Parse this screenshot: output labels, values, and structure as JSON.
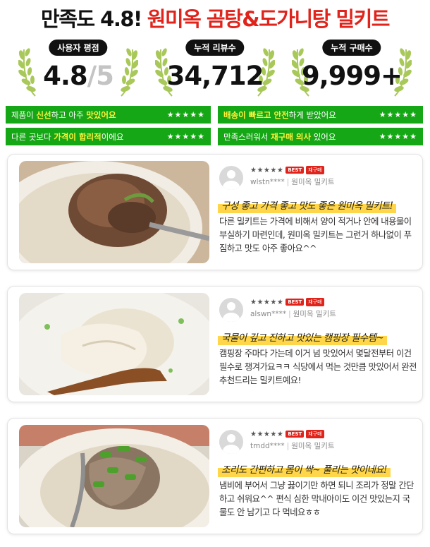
{
  "title": {
    "part1": "만족도 4.8!",
    "part2": "원미옥 곰탕&도가니탕 밀키트"
  },
  "stats": [
    {
      "label": "사용자 평점",
      "value": "4.8",
      "suffix": "/5"
    },
    {
      "label": "누적 리뷰수",
      "value": "34,712",
      "suffix": ""
    },
    {
      "label": "누적 구매수",
      "value": "9,999+",
      "suffix": ""
    }
  ],
  "bars": [
    {
      "pre": "제품이 ",
      "hl1": "신선",
      "mid": "하고 아주 ",
      "hl2": "맛있어요",
      "post": "",
      "stars": "★★★★★"
    },
    {
      "pre": "",
      "hl1": "배송이 빠르고 안전",
      "mid": "하게 받았어요",
      "hl2": "",
      "post": "",
      "stars": "★★★★★"
    },
    {
      "pre": "다른 곳보다 ",
      "hl1": "가격이 합리적",
      "mid": "이에요",
      "hl2": "",
      "post": "",
      "stars": "★★★★★"
    },
    {
      "pre": "만족",
      "hl1": "",
      "mid": "스러워서 ",
      "hl2": "재구매 의사",
      "post": " 있어요",
      "stars": "★★★★★"
    }
  ],
  "reviews": [
    {
      "stars": "★★★★★",
      "best": "BEST",
      "tag": "재구매",
      "user": "wlstn****",
      "product": "원미옥 밀키트",
      "headline": "구성 좋고 가격 좋고 맛도 좋은 원미옥 밀키트!",
      "body": "다른 밀키트는 가격에 비해서 양이 적거나 안에 내용물이 부실하기 마련인데, 원미옥 밀키트는 그런거 하나없이 푸짐하고 맛도 아주 좋아요^^"
    },
    {
      "stars": "★★★★★",
      "best": "BEST",
      "tag": "재구매",
      "user": "alswn****",
      "product": "원미옥 밀키트",
      "headline": "국물이 깊고 진하고 맛있는 캠핑장 필수템~",
      "body": "캠핑장 주마다 가는데 이거 넘 맛있어서 몇달전부터 이건 필수로 챙겨가요ㅋㅋ 식당에서 먹는 것만큼 맛있어서 완전 추천드리는 밀키트예요!"
    },
    {
      "stars": "★★★★★",
      "best": "BEST",
      "tag": "재구매",
      "user": "tmdd****",
      "product": "원미옥 밀키트",
      "headline": "조리도 간편하고 몸이 싹~ 풀리는 맛이네요!",
      "body": "냄비에 부어서 그냥 끓이기만 하면 되니 조리가 정말 간단하고 쉬워요^^ 편식 심한 막내아이도 이건 맛있는지 국물도 안 남기고 다 먹네요ㅎㅎ"
    }
  ]
}
